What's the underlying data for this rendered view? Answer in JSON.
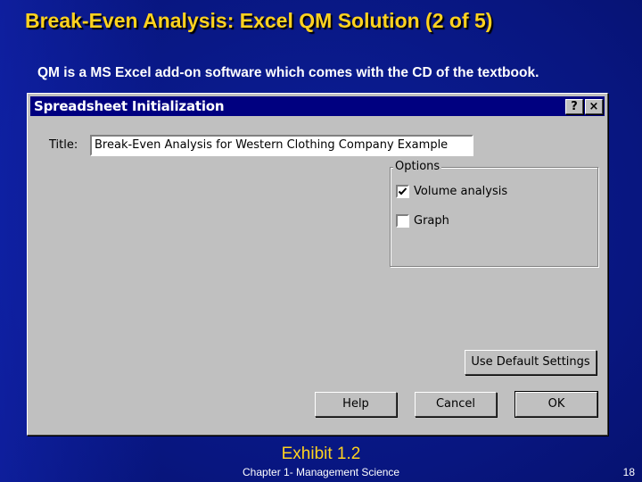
{
  "slide": {
    "title": "Break-Even Analysis: Excel QM Solution (2 of 5)",
    "subtitle": "QM is a MS Excel add-on software which comes with the CD of the textbook.",
    "caption": "Exhibit 1.2",
    "footer": "Chapter 1- Management Science",
    "page_number": "18"
  },
  "dialog": {
    "title": "Spreadsheet Initialization",
    "help_glyph": "?",
    "close_glyph": "×",
    "title_label": "Title:",
    "title_value": "Break-Even Analysis for Western Clothing Company Example",
    "options": {
      "legend": "Options",
      "items": [
        {
          "label": "Volume analysis",
          "checked": true
        },
        {
          "label": "Graph",
          "checked": false
        }
      ]
    },
    "buttons": {
      "defaults": "Use Default Settings",
      "help": "Help",
      "cancel": "Cancel",
      "ok": "OK"
    }
  },
  "colors": {
    "background": "#0a1a8c",
    "title_yellow": "#ffd21f",
    "dialog_gray": "#c0c0c0",
    "titlebar_navy": "#000080"
  }
}
